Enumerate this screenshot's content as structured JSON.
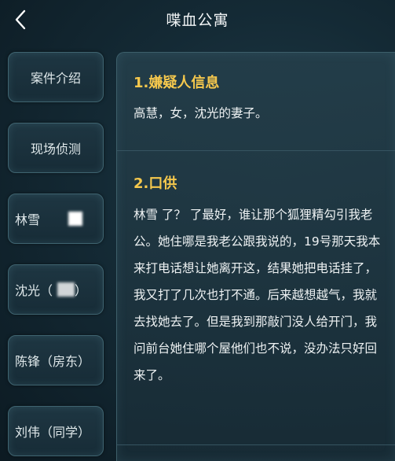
{
  "header": {
    "title": "喋血公寓"
  },
  "sidebar": {
    "items": [
      {
        "label": "案件介绍"
      },
      {
        "label": "现场侦测"
      },
      {
        "label": "林雪"
      },
      {
        "label": "沈光（",
        "suffix": "）"
      },
      {
        "label": "陈锋（房东）"
      },
      {
        "label": "刘伟（同学）"
      }
    ]
  },
  "main": {
    "section1": {
      "heading": "1.嫌疑人信息",
      "body": "高慧，女，沈光的妻子。"
    },
    "section2": {
      "heading": "2.口供",
      "body": "林雪 了？ 了最好，谁让那个狐狸精勾引我老公。她住哪是我老公跟我说的，19号那天我本来打电话想让她离开这，结果她把电话挂了，我又打了几次也打不通。后来越想越气，我就去找她去了。但是我到那敲门没人给开门，我问前台她住哪个屋他们也不说，没办法只好回来了。"
    }
  },
  "colors": {
    "accent": "#f5c84d",
    "background": "#142a35",
    "border": "#3f6470"
  }
}
